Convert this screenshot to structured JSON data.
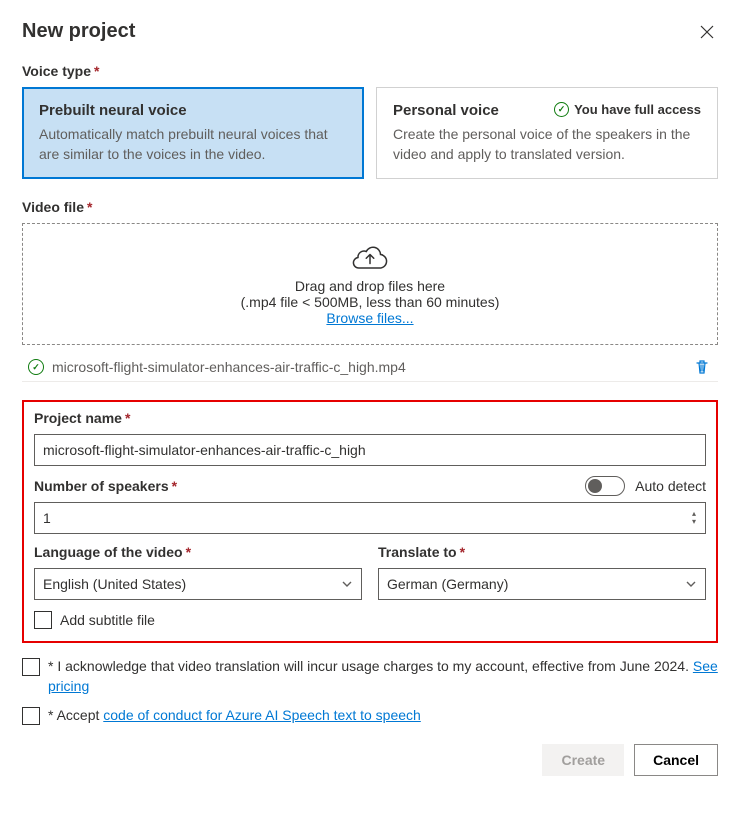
{
  "header": {
    "title": "New project"
  },
  "voice_type": {
    "label": "Voice type",
    "cards": [
      {
        "title": "Prebuilt neural voice",
        "desc": "Automatically match prebuilt neural voices that are similar to the voices in the video."
      },
      {
        "title": "Personal voice",
        "desc": "Create the personal voice of the speakers in the video and apply to translated version.",
        "badge": "You have full access"
      }
    ]
  },
  "video_file": {
    "label": "Video file",
    "dz_text": "Drag and drop files here",
    "dz_sub": "(.mp4 file < 500MB, less than 60 minutes)",
    "browse": "Browse files...",
    "uploaded": "microsoft-flight-simulator-enhances-air-traffic-c_high.mp4"
  },
  "form": {
    "project_name_label": "Project name",
    "project_name_value": "microsoft-flight-simulator-enhances-air-traffic-c_high",
    "speakers_label": "Number of speakers",
    "speakers_value": "1",
    "auto_detect_label": "Auto detect",
    "lang_label": "Language of the video",
    "lang_value": "English (United States)",
    "translate_label": "Translate to",
    "translate_value": "German (Germany)",
    "subtitle_label": "Add subtitle file"
  },
  "ack": {
    "charges_prefix": "* I acknowledge that video translation will incur usage charges to my account, effective from June 2024. ",
    "see_pricing": "See pricing",
    "accept_prefix": "* Accept ",
    "coc_link": "code of conduct for Azure AI Speech text to speech"
  },
  "footer": {
    "create": "Create",
    "cancel": "Cancel"
  }
}
